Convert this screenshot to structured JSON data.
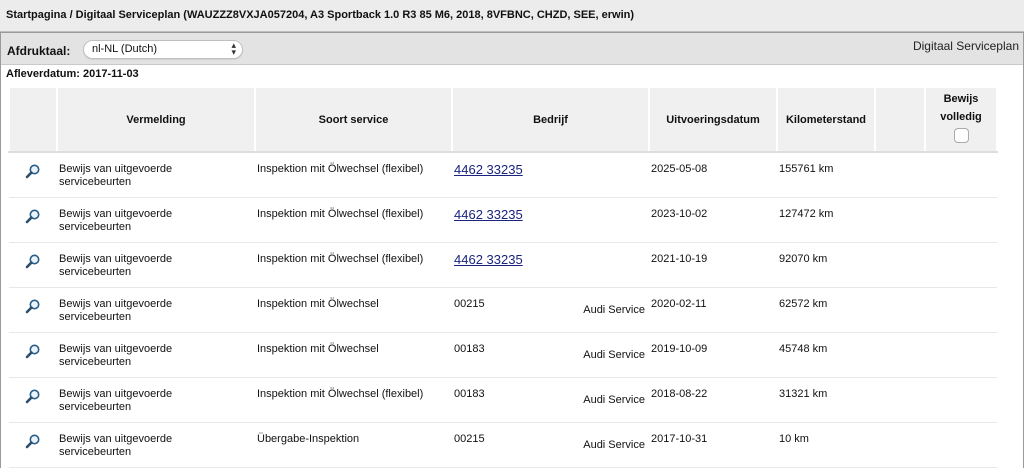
{
  "window": {
    "title": "Startpagina / Digitaal Serviceplan (WAUZZZ8VXJA057204, A3 Sportback 1.0 R3 85 M6, 2018, 8VFBNC, CHZD, SEE, erwin)"
  },
  "toolbar": {
    "print_label": "Afdruktaal:",
    "language_value": "nl-NL (Dutch)",
    "plan_title": "Digitaal Serviceplan"
  },
  "delivery": {
    "text": "Afleverdatum: 2017-11-03"
  },
  "table": {
    "headers": {
      "entry": "Vermelding",
      "service_type": "Soort service",
      "company": "Bedrijf",
      "date": "Uitvoeringsdatum",
      "mileage": "Kilometerstand",
      "proof_line1": "Bewijs",
      "proof_line2": "volledig"
    },
    "rows": [
      {
        "entry_line1": "Bewijs van uitgevoerde",
        "entry_line2": "servicebeurten",
        "service_type": "Inspektion mit Ölwechsel (flexibel)",
        "company": "4462 33235",
        "service_name": "",
        "date": "2025-05-08",
        "mileage": "155761 km"
      },
      {
        "entry_line1": "Bewijs van uitgevoerde",
        "entry_line2": "servicebeurten",
        "service_type": "Inspektion mit Ölwechsel (flexibel)",
        "company": "4462 33235",
        "service_name": "",
        "date": "2023-10-02",
        "mileage": "127472 km"
      },
      {
        "entry_line1": "Bewijs van uitgevoerde",
        "entry_line2": "servicebeurten",
        "service_type": "Inspektion mit Ölwechsel (flexibel)",
        "company": "4462 33235",
        "service_name": "",
        "date": "2021-10-19",
        "mileage": "92070 km"
      },
      {
        "entry_line1": "Bewijs van uitgevoerde",
        "entry_line2": "servicebeurten",
        "service_type": "Inspektion mit Ölwechsel",
        "company": "00215",
        "service_name": "Audi Service",
        "date": "2020-02-11",
        "mileage": "62572 km"
      },
      {
        "entry_line1": "Bewijs van uitgevoerde",
        "entry_line2": "servicebeurten",
        "service_type": "Inspektion mit Ölwechsel",
        "company": "00183",
        "service_name": "Audi Service",
        "date": "2019-10-09",
        "mileage": "45748 km"
      },
      {
        "entry_line1": "Bewijs van uitgevoerde",
        "entry_line2": "servicebeurten",
        "service_type": "Inspektion mit Ölwechsel (flexibel)",
        "company": "00183",
        "service_name": "Audi Service",
        "date": "2018-08-22",
        "mileage": "31321 km"
      },
      {
        "entry_line1": "Bewijs van uitgevoerde",
        "entry_line2": "servicebeurten",
        "service_type": "Übergabe-Inspektion",
        "company": "00215",
        "service_name": "Audi Service",
        "date": "2017-10-31",
        "mileage": "10 km"
      }
    ],
    "linked_rows": [
      0,
      1,
      2
    ]
  },
  "icons": {
    "detail": "magnifier-icon",
    "dropdown": "chevron-updown-icon"
  },
  "colors": {
    "link": "#1a237e",
    "header_bg": "#f0f0f0",
    "toolbar_bg": "#e3e3e3"
  }
}
